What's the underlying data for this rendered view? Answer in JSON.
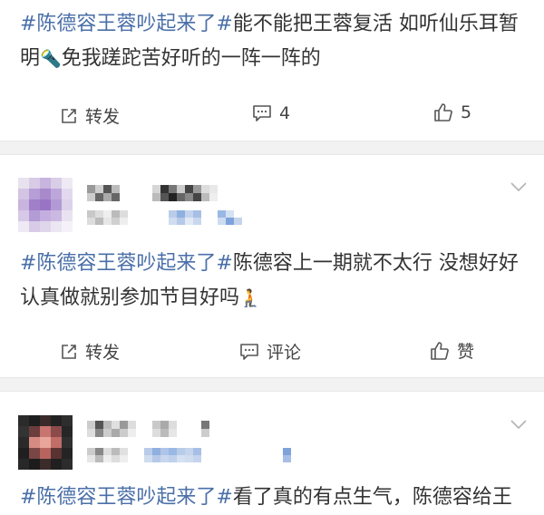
{
  "posts": [
    {
      "text_hashtag": "#陈德容王蓉吵起来了#",
      "text_line1_rest": "能不能把王蓉复活 如听仙乐耳暂",
      "text_line2_a": "明",
      "emoji_1": "🔦",
      "text_line2_b": "免我蹉跎苦好听的一阵一阵的",
      "actions": {
        "repost": "转发",
        "comment": "4",
        "like": "5"
      }
    },
    {
      "text_hashtag": "#陈德容王蓉吵起来了#",
      "text_line1_rest": "陈德容上一期就不太行 没想好好",
      "text_line2_a": "认真做就别参加节目好吗",
      "emoji_1": "🧎",
      "actions": {
        "repost": "转发",
        "comment": "评论",
        "like": "赞"
      }
    },
    {
      "text_hashtag": "#陈德容王蓉吵起来了#",
      "text_line1_rest": "看了真的有点生气，陈德容给王"
    }
  ],
  "icons": {
    "repost": "repost-icon",
    "comment": "comment-icon",
    "like": "thumbs-up-icon",
    "more": "chevron-down-icon"
  },
  "colors": {
    "hashtag": "#4a6fa8",
    "text": "#333333",
    "divider": "#f2f2f2"
  }
}
